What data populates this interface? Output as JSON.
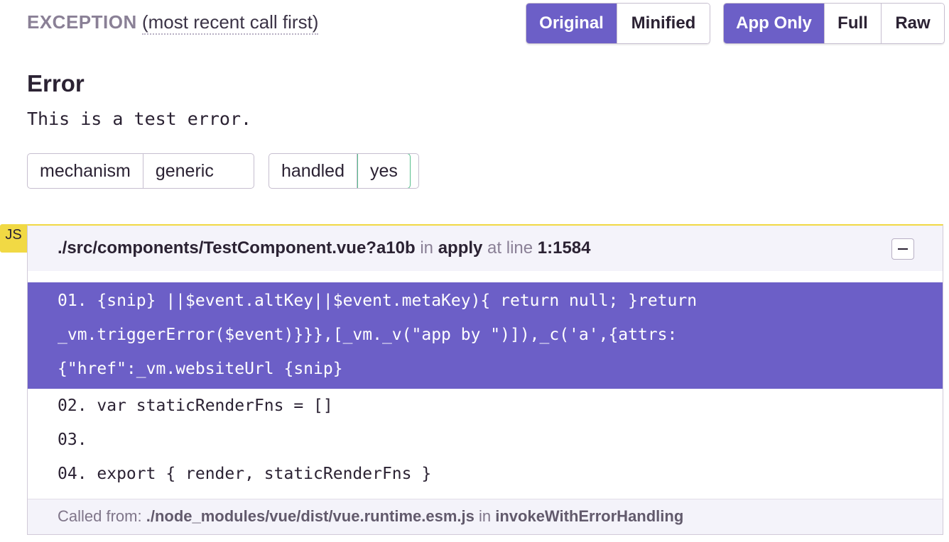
{
  "header": {
    "title": "EXCEPTION",
    "subtitle": "(most recent call first)"
  },
  "source_toggle": {
    "options": [
      "Original",
      "Minified"
    ],
    "active": "Original"
  },
  "view_toggle": {
    "options": [
      "App Only",
      "Full",
      "Raw"
    ],
    "active": "App Only"
  },
  "error": {
    "type": "Error",
    "message": "This is a test error."
  },
  "tags": [
    {
      "key": "mechanism",
      "value": "generic"
    },
    {
      "key": "handled",
      "value": "yes"
    }
  ],
  "frame": {
    "platform_badge": "JS",
    "file": "./src/components/TestComponent.vue?a10b",
    "in_label": "in",
    "function": "apply",
    "at_label": "at line",
    "line": "1:1584",
    "highlighted_lines": [
      "01. {snip} ||$event.altKey||$event.metaKey){ return null; }return",
      "_vm.triggerError($event)}}},[_vm._v(\"app by \")]),_c('a',{attrs:",
      "{\"href\":_vm.websiteUrl {snip}"
    ],
    "context_lines": [
      "02. var staticRenderFns = []",
      "03.",
      "04. export { render, staticRenderFns }"
    ],
    "called_from_label": "Called from:",
    "called_from_file": "./node_modules/vue/dist/vue.runtime.esm.js",
    "called_from_in": "in",
    "called_from_function": "invokeWithErrorHandling"
  },
  "colors": {
    "accent": "#6c5fc7",
    "badge": "#f1d944",
    "handled_border": "#57be8c"
  }
}
